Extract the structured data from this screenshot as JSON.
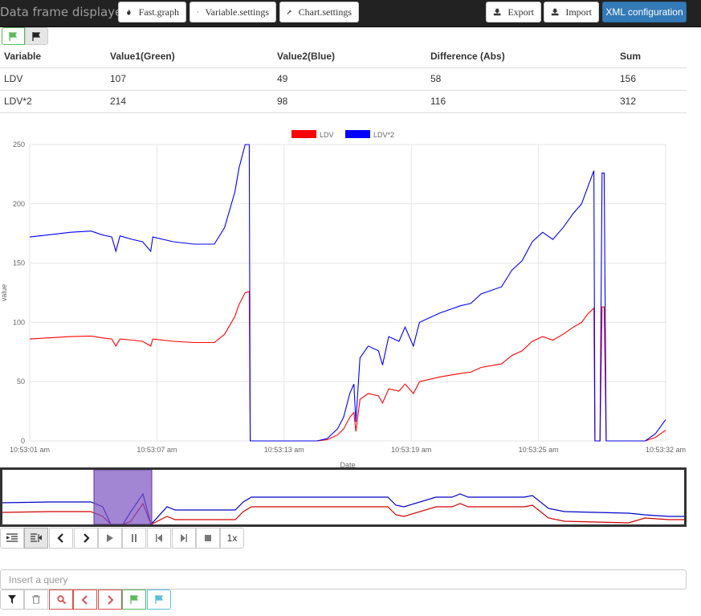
{
  "app": {
    "title": "Data frame displayer"
  },
  "toolbar": {
    "fast_graph": "Fast.graph",
    "variable_settings": "Variable.settings",
    "chart_settings": "Chart.settings",
    "export": "Export",
    "import": "Import",
    "xml_config": "XML configuration"
  },
  "table": {
    "headers": [
      "Variable",
      "Value1(Green)",
      "Value2(Blue)",
      "Difference (Abs)",
      "Sum"
    ],
    "rows": [
      [
        "LDV",
        "107",
        "49",
        "58",
        "156"
      ],
      [
        "LDV*2",
        "214",
        "98",
        "116",
        "312"
      ]
    ]
  },
  "chart_data": {
    "type": "line",
    "xlabel": "Date",
    "ylabel": "value",
    "ylim": [
      0,
      250
    ],
    "yticks": [
      "0",
      "50",
      "100",
      "150",
      "200",
      "250"
    ],
    "xticks": [
      "10:53:01 am",
      "10:53:07 am",
      "10:53:13 am",
      "10:53:19 am",
      "10:53:25 am",
      "10:53:32 am"
    ],
    "x_range_seconds": [
      0,
      31
    ],
    "grid": true,
    "legend_position": "top-center",
    "series": [
      {
        "name": "LDV",
        "color": "#ff0000",
        "points": [
          [
            0,
            86
          ],
          [
            1,
            87
          ],
          [
            2,
            88
          ],
          [
            3,
            88.5
          ],
          [
            3.5,
            87
          ],
          [
            4,
            86
          ],
          [
            4.2,
            80
          ],
          [
            4.4,
            86
          ],
          [
            5,
            85
          ],
          [
            5.5,
            84
          ],
          [
            5.9,
            80
          ],
          [
            6,
            86
          ],
          [
            7,
            84
          ],
          [
            8,
            83
          ],
          [
            9,
            83
          ],
          [
            9.5,
            90
          ],
          [
            10,
            105
          ],
          [
            10.2,
            115
          ],
          [
            10.5,
            125
          ],
          [
            10.7,
            126
          ],
          [
            10.75,
            0
          ],
          [
            12,
            0
          ],
          [
            14,
            0
          ],
          [
            14.5,
            1
          ],
          [
            15,
            5
          ],
          [
            15.3,
            10
          ],
          [
            15.6,
            20
          ],
          [
            15.8,
            24
          ],
          [
            15.9,
            8
          ],
          [
            16.1,
            35
          ],
          [
            16.5,
            40
          ],
          [
            17,
            38
          ],
          [
            17.2,
            32
          ],
          [
            17.5,
            44
          ],
          [
            18,
            42
          ],
          [
            18.3,
            48
          ],
          [
            18.7,
            40
          ],
          [
            19,
            50
          ],
          [
            20,
            54
          ],
          [
            21,
            57
          ],
          [
            21.5,
            58
          ],
          [
            22,
            62
          ],
          [
            23,
            65
          ],
          [
            23.5,
            72
          ],
          [
            24,
            76
          ],
          [
            24.5,
            84
          ],
          [
            25,
            88
          ],
          [
            25.5,
            85
          ],
          [
            26,
            90
          ],
          [
            26.5,
            96
          ],
          [
            26.9,
            100
          ],
          [
            27.2,
            107
          ],
          [
            27.5,
            112
          ],
          [
            27.55,
            0
          ],
          [
            27.8,
            0
          ],
          [
            27.9,
            113
          ],
          [
            28,
            113
          ],
          [
            28.1,
            0
          ],
          [
            30,
            0
          ],
          [
            30.5,
            3
          ],
          [
            31,
            9
          ]
        ]
      },
      {
        "name": "LDV*2",
        "color": "#0000ff",
        "points": [
          [
            0,
            172
          ],
          [
            1,
            174
          ],
          [
            2,
            176
          ],
          [
            3,
            177
          ],
          [
            3.5,
            174
          ],
          [
            4,
            172
          ],
          [
            4.2,
            160
          ],
          [
            4.4,
            173
          ],
          [
            5,
            170
          ],
          [
            5.5,
            168
          ],
          [
            5.9,
            160
          ],
          [
            6,
            172
          ],
          [
            7,
            168
          ],
          [
            8,
            166
          ],
          [
            9,
            166
          ],
          [
            9.5,
            180
          ],
          [
            10,
            210
          ],
          [
            10.2,
            230
          ],
          [
            10.5,
            250
          ],
          [
            10.7,
            250
          ],
          [
            10.75,
            0
          ],
          [
            12,
            0
          ],
          [
            14,
            0
          ],
          [
            14.5,
            2
          ],
          [
            15,
            10
          ],
          [
            15.3,
            20
          ],
          [
            15.6,
            40
          ],
          [
            15.8,
            48
          ],
          [
            15.9,
            16
          ],
          [
            16.1,
            70
          ],
          [
            16.5,
            80
          ],
          [
            17,
            76
          ],
          [
            17.2,
            64
          ],
          [
            17.5,
            88
          ],
          [
            18,
            84
          ],
          [
            18.3,
            96
          ],
          [
            18.7,
            80
          ],
          [
            19,
            100
          ],
          [
            20,
            108
          ],
          [
            21,
            114
          ],
          [
            21.5,
            116
          ],
          [
            22,
            124
          ],
          [
            23,
            130
          ],
          [
            23.5,
            144
          ],
          [
            24,
            152
          ],
          [
            24.5,
            168
          ],
          [
            25,
            176
          ],
          [
            25.5,
            170
          ],
          [
            26,
            180
          ],
          [
            26.5,
            192
          ],
          [
            26.9,
            200
          ],
          [
            27.2,
            214
          ],
          [
            27.5,
            228
          ],
          [
            27.55,
            0
          ],
          [
            27.8,
            0
          ],
          [
            27.9,
            226
          ],
          [
            28,
            226
          ],
          [
            28.1,
            0
          ],
          [
            30,
            0
          ],
          [
            30.5,
            6
          ],
          [
            31,
            18
          ]
        ]
      }
    ]
  },
  "overview": {
    "colors": {
      "red": "#d00000",
      "blue": "#0000c8",
      "selection": "#7b52c2"
    }
  },
  "playback": {
    "speed": "1x"
  },
  "query": {
    "placeholder": "Insert a query"
  }
}
